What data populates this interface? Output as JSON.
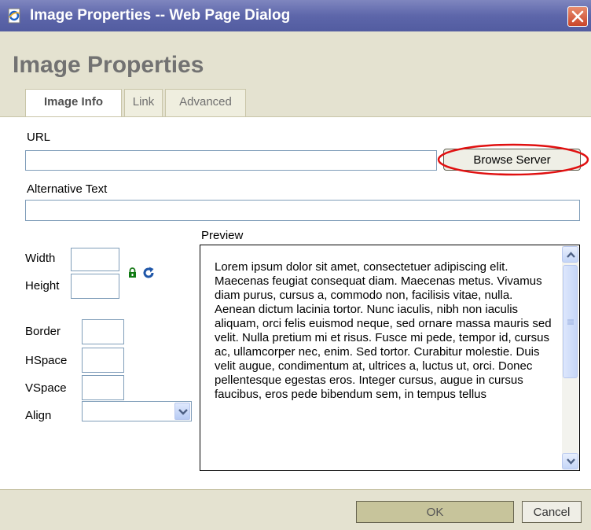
{
  "window": {
    "title": "Image Properties -- Web Page Dialog",
    "close_icon": "close-icon"
  },
  "dialog": {
    "title": "Image Properties"
  },
  "tabs": [
    {
      "label": "Image Info",
      "active": true
    },
    {
      "label": "Link",
      "active": false
    },
    {
      "label": "Advanced",
      "active": false
    }
  ],
  "form": {
    "url_label": "URL",
    "url_value": "",
    "browse_label": "Browse Server",
    "alt_label": "Alternative Text",
    "alt_value": "",
    "width_label": "Width",
    "height_label": "Height",
    "border_label": "Border",
    "hspace_label": "HSpace",
    "vspace_label": "VSpace",
    "align_label": "Align",
    "align_value": ""
  },
  "preview": {
    "label": "Preview",
    "text": "Lorem ipsum dolor sit amet, consectetuer adipiscing elit. Maecenas feugiat consequat diam. Maecenas metus. Vivamus diam purus, cursus a, commodo non, facilisis vitae, nulla. Aenean dictum lacinia tortor. Nunc iaculis, nibh non iaculis aliquam, orci felis euismod neque, sed ornare massa mauris sed velit. Nulla pretium mi et risus. Fusce mi pede, tempor id, cursus ac, ullamcorper nec, enim. Sed tortor. Curabitur molestie. Duis velit augue, condimentum at, ultrices a, luctus ut, orci. Donec pellentesque egestas eros. Integer cursus, augue in cursus faucibus, eros pede bibendum sem, in tempus tellus"
  },
  "footer": {
    "ok_label": "OK",
    "cancel_label": "Cancel"
  },
  "colors": {
    "titlebar": "#5d66aa",
    "panel": "#e4e2d0",
    "highlight": "#e01010"
  }
}
